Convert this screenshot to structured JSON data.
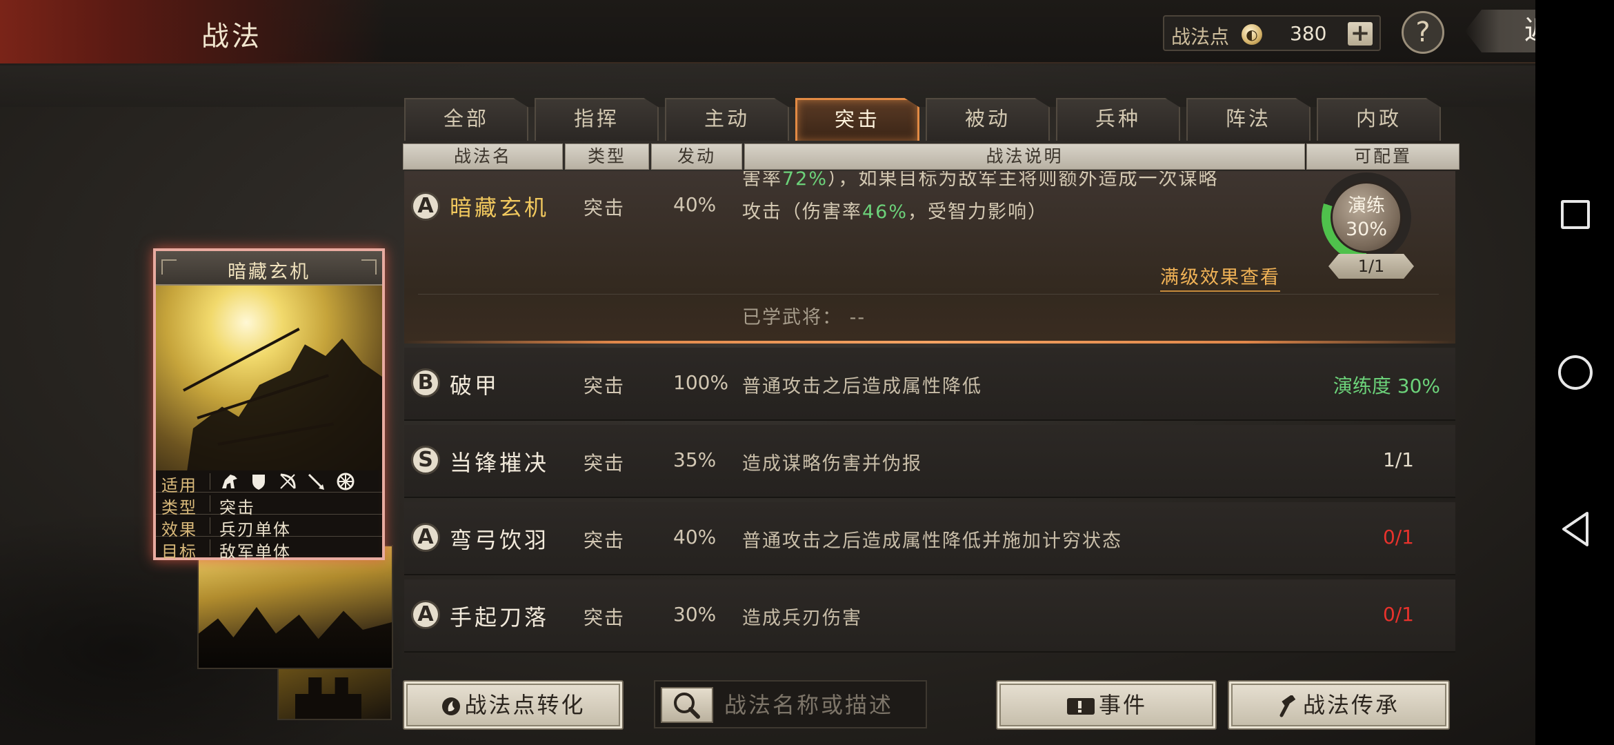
{
  "header": {
    "title": "战法",
    "points_label": "战法点",
    "points_value": "380",
    "plus_label": "+",
    "help_label": "?",
    "back_label": "返回"
  },
  "tabs": [
    {
      "label": "全部",
      "active": false
    },
    {
      "label": "指挥",
      "active": false
    },
    {
      "label": "主动",
      "active": false
    },
    {
      "label": "突击",
      "active": true
    },
    {
      "label": "被动",
      "active": false
    },
    {
      "label": "兵种",
      "active": false
    },
    {
      "label": "阵法",
      "active": false
    },
    {
      "label": "内政",
      "active": false
    }
  ],
  "table_headers": {
    "name": "战法名",
    "type": "类型",
    "trigger": "发动",
    "desc": "战法说明",
    "config": "可配置"
  },
  "card": {
    "name": "暗藏玄机",
    "applicable_label": "适用",
    "type_label": "类型",
    "type_value": "突击",
    "effect_label": "效果",
    "effect_value": "兵刃单体",
    "target_label": "目标",
    "target_value": "敌军单体",
    "unit_icons": [
      "cavalry-icon",
      "shield-icon",
      "bow-icon",
      "spear-icon",
      "wheel-icon"
    ]
  },
  "expanded_row": {
    "grade": "A",
    "name": "暗藏玄机",
    "type": "突击",
    "rate": "40%",
    "desc_line1_pre": "害率",
    "desc_line1_val": "72%",
    "desc_line1_post": "），如果目标为敌军主将则额外造成一次谋略",
    "desc_line2_pre": "攻击（伤害率",
    "desc_line2_val": "46%",
    "desc_line2_post": "，受智力影响）",
    "max_level_link": "满级效果查看",
    "learned_label": "已学武将：",
    "learned_value": "--",
    "train_label": "演练",
    "train_percent": "30%",
    "train_progress": 0.3,
    "count": "1/1"
  },
  "rows": [
    {
      "grade": "B",
      "name": "破甲",
      "type": "突击",
      "rate": "100%",
      "desc": "普通攻击之后造成属性降低",
      "config": "演练度 30%",
      "config_color": "green"
    },
    {
      "grade": "S",
      "name": "当锋摧决",
      "type": "突击",
      "rate": "35%",
      "desc": "造成谋略伤害并伪报",
      "config": "1/1",
      "config_color": "white"
    },
    {
      "grade": "A",
      "name": "弯弓饮羽",
      "type": "突击",
      "rate": "40%",
      "desc": "普通攻击之后造成属性降低并施加计穷状态",
      "config": "0/1",
      "config_color": "red"
    },
    {
      "grade": "A",
      "name": "手起刀落",
      "type": "突击",
      "rate": "30%",
      "desc": "造成兵刃伤害",
      "config": "0/1",
      "config_color": "red"
    }
  ],
  "bottom": {
    "convert_label": "战法点转化",
    "search_placeholder": "战法名称或描述",
    "event_label": "事件",
    "inherit_label": "战法传承"
  },
  "colors": {
    "accent_orange": "#e28a44",
    "progress_green": "#4fc14c",
    "status_red": "#e8322c",
    "gold_text": "#f1c85e"
  }
}
